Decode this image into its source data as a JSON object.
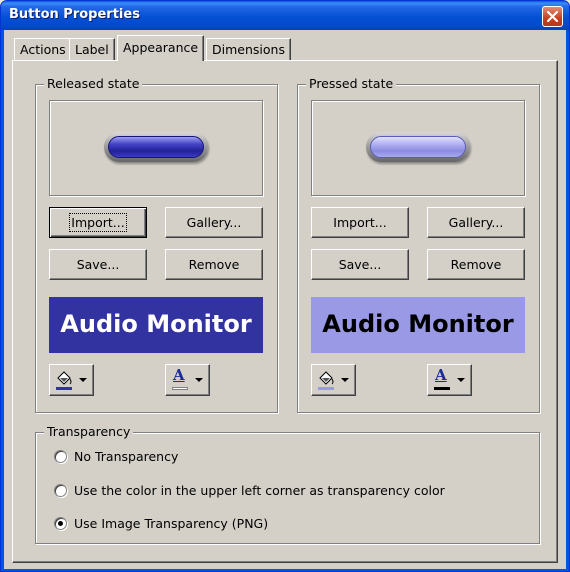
{
  "window": {
    "title": "Button Properties"
  },
  "tabs": [
    {
      "label": "Actions",
      "active": false
    },
    {
      "label": "Label",
      "active": false
    },
    {
      "label": "Appearance",
      "active": true
    },
    {
      "label": "Dimensions",
      "active": false
    }
  ],
  "released": {
    "group_label": "Released state",
    "import_label": "Import...",
    "gallery_label": "Gallery...",
    "save_label": "Save...",
    "remove_label": "Remove",
    "preview_text": "Audio Monitor",
    "background_color": "#3232a0",
    "text_color": "#ffffff",
    "fill_swatch_color": "#3232a0",
    "font_swatch_color": "#ffffff"
  },
  "pressed": {
    "group_label": "Pressed state",
    "import_label": "Import...",
    "gallery_label": "Gallery...",
    "save_label": "Save...",
    "remove_label": "Remove",
    "preview_text": "Audio Monitor",
    "background_color": "#9999e6",
    "text_color": "#000000",
    "fill_swatch_color": "#9999e6",
    "font_swatch_color": "#000000"
  },
  "transparency": {
    "group_label": "Transparency",
    "options": [
      {
        "label": "No Transparency",
        "checked": false
      },
      {
        "label": "Use the color in the upper left corner as transparency color",
        "checked": false
      },
      {
        "label": "Use Image Transparency (PNG)",
        "checked": true
      }
    ]
  },
  "icons": {
    "close": "close-icon",
    "fill_color": "paint-bucket-icon",
    "font_color": "font-color-icon",
    "dropdown": "dropdown-arrow-icon"
  }
}
